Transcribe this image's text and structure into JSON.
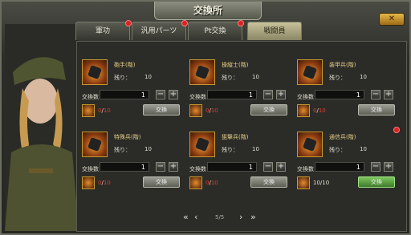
{
  "window": {
    "title": "交換所",
    "close_label": "✕"
  },
  "tabs": [
    {
      "label": "軍功",
      "badge": true,
      "active": false
    },
    {
      "label": "汎用パーツ",
      "badge": true,
      "active": false
    },
    {
      "label": "Pt交換",
      "badge": true,
      "active": false
    },
    {
      "label": "戦闘員",
      "badge": false,
      "active": true
    }
  ],
  "items": [
    {
      "name": "砲手(階)",
      "remain_label": "残り：",
      "remain": "10",
      "qty_label": "交換数",
      "qty": "1",
      "have_current": "0",
      "have_required": "10",
      "button": "交換",
      "button_enabled": false,
      "alert": false
    },
    {
      "name": "操縦士(階)",
      "remain_label": "残り：",
      "remain": "10",
      "qty_label": "交換数",
      "qty": "1",
      "have_current": "0",
      "have_required": "10",
      "button": "交換",
      "button_enabled": false,
      "alert": false
    },
    {
      "name": "装甲兵(階)",
      "remain_label": "残り：",
      "remain": "10",
      "qty_label": "交換数",
      "qty": "1",
      "have_current": "0",
      "have_required": "10",
      "button": "交換",
      "button_enabled": false,
      "alert": false
    },
    {
      "name": "特殊兵(階)",
      "remain_label": "残り：",
      "remain": "10",
      "qty_label": "交換数",
      "qty": "1",
      "have_current": "0",
      "have_required": "10",
      "button": "交換",
      "button_enabled": false,
      "alert": false
    },
    {
      "name": "狙撃兵(階)",
      "remain_label": "残り：",
      "remain": "10",
      "qty_label": "交換数",
      "qty": "1",
      "have_current": "0",
      "have_required": "10",
      "button": "交換",
      "button_enabled": false,
      "alert": false
    },
    {
      "name": "通信兵(階)",
      "remain_label": "残り：",
      "remain": "10",
      "qty_label": "交換数",
      "qty": "1",
      "have_current": "10",
      "have_required": "10",
      "button": "交換",
      "button_enabled": true,
      "alert": true
    }
  ],
  "pager": {
    "first": "«",
    "prev": "‹",
    "page": "5/5",
    "next": "›",
    "last": "»"
  },
  "colors": {
    "accent": "#c79a2f",
    "active_tab": "#c7c29a",
    "alert": "#d42424",
    "exchange_ready": "#5aa040"
  }
}
